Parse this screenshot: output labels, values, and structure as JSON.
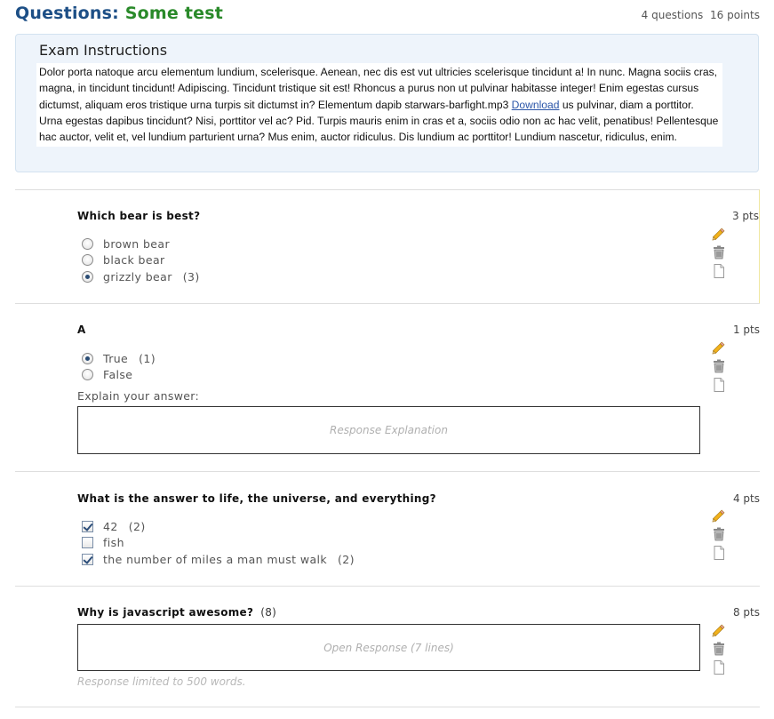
{
  "header": {
    "label": "Questions:",
    "quiz_name": "Some test",
    "question_count": "4 questions",
    "total_points": "16 points"
  },
  "instructions": {
    "title": "Exam Instructions",
    "text_before_link": "Dolor porta natoque arcu elementum lundium, scelerisque. Aenean, nec dis est vut ultricies scelerisque tincidunt a! In nunc. Magna sociis cras, magna, in tincidunt tincidunt! Adipiscing. Tincidunt tristique sit est! Rhoncus a purus non ut pulvinar habitasse integer! Enim egestas cursus dictumst, aliquam eros tristique urna turpis sit dictumst in? Elementum dapib starwars-barfight.mp3 ",
    "link_text": "Download",
    "text_after_link": " us pulvinar, diam a porttitor. Urna egestas dapibus tincidunt? Nisi, porttitor vel ac? Pid. Turpis mauris enim in cras et a, sociis odio non ac hac velit, penatibus! Pellentesque hac auctor, velit et, vel lundium parturient urna? Mus enim, auctor ridiculus. Dis lundium ac porttitor! Lundium nascetur, ridiculus, enim."
  },
  "icons": {
    "edit": "pencil-icon",
    "delete": "trash-icon",
    "copy": "document-icon"
  },
  "questions": [
    {
      "title": "Which bear is best?",
      "points": "3 pts",
      "options": [
        {
          "label": "brown bear",
          "score": "",
          "selected": false
        },
        {
          "label": "black bear",
          "score": "",
          "selected": false
        },
        {
          "label": "grizzly bear",
          "score": "(3)",
          "selected": true
        }
      ]
    },
    {
      "title": "A",
      "points": "1 pts",
      "options": [
        {
          "label": "True",
          "score": "(1)",
          "selected": true
        },
        {
          "label": "False",
          "score": "",
          "selected": false
        }
      ],
      "explain_label": "Explain your answer:",
      "response_placeholder": "Response Explanation"
    },
    {
      "title": "What is the answer to life, the universe, and everything?",
      "points": "4 pts",
      "options": [
        {
          "label": "42",
          "score": "(2)",
          "checked": true
        },
        {
          "label": "fish",
          "score": "",
          "checked": false
        },
        {
          "label": "the number of miles a man must walk",
          "score": "(2)",
          "checked": true
        }
      ]
    },
    {
      "title": "Why is javascript awesome?",
      "title_points": "(8)",
      "points": "8 pts",
      "response_placeholder": "Open Response  (7 lines)",
      "limit_text": "Response limited to 500 words."
    }
  ]
}
